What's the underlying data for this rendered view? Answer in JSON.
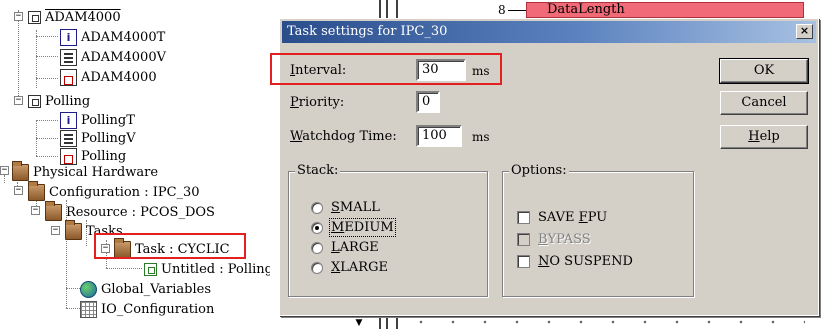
{
  "tree": {
    "items": [
      {
        "label": "ADAM4000",
        "icon": "program-group-icon"
      },
      {
        "label": "ADAM4000T",
        "icon": "type-icon"
      },
      {
        "label": "ADAM4000V",
        "icon": "variables-icon"
      },
      {
        "label": "ADAM4000",
        "icon": "program-icon"
      },
      {
        "label": "Polling",
        "icon": "program-group-icon"
      },
      {
        "label": "PollingT",
        "icon": "type-icon"
      },
      {
        "label": "PollingV",
        "icon": "variables-icon"
      },
      {
        "label": "Polling",
        "icon": "program-icon"
      },
      {
        "label": "Physical Hardware",
        "icon": "folder-icon"
      },
      {
        "label": "Configuration : IPC_30",
        "icon": "folder-icon"
      },
      {
        "label": "Resource : PCOS_DOS",
        "icon": "folder-icon"
      },
      {
        "label": "Tasks",
        "icon": "folder-icon"
      },
      {
        "label": "Task : CYCLIC",
        "icon": "folder-icon"
      },
      {
        "label": "Untitled : Polling",
        "icon": "program-instance-icon"
      },
      {
        "label": "Global_Variables",
        "icon": "globe-icon"
      },
      {
        "label": "IO_Configuration",
        "icon": "grid-icon"
      }
    ]
  },
  "background": {
    "diagram_number": "8",
    "diagram_label": "DataLength"
  },
  "dialog": {
    "title": "Task settings for IPC_30",
    "close_glyph": "×",
    "interval_label_u": "I",
    "interval_label_rest": "nterval:",
    "interval_value": "30",
    "interval_unit": "ms",
    "priority_label_u": "P",
    "priority_label_rest": "riority:",
    "priority_value": "0",
    "watchdog_label_u": "W",
    "watchdog_label_rest": "atchdog Time:",
    "watchdog_value": "100",
    "watchdog_unit": "ms",
    "ok_label": "OK",
    "cancel_label": "Cancel",
    "help_label_u": "H",
    "help_label_rest": "elp",
    "stack": {
      "title": "Stack:",
      "options": [
        {
          "u": "S",
          "rest": "MALL",
          "selected": false
        },
        {
          "u": "M",
          "rest": "EDIUM",
          "selected": true
        },
        {
          "u": "L",
          "rest": "ARGE",
          "selected": false
        },
        {
          "u": "X",
          "rest": "LARGE",
          "selected": false
        }
      ]
    },
    "options_group": {
      "title": "Options:",
      "save_fpu_pre": "SAVE ",
      "save_fpu_u": "F",
      "save_fpu_rest": "PU",
      "bypass_u": "B",
      "bypass_rest": "YPASS",
      "no_suspend_u": "N",
      "no_suspend_rest": "O SUSPEND"
    }
  },
  "colors": {
    "highlight": "#e22020",
    "titlebar_start": "#2a4d8c",
    "dialog_bg": "#d4d0c8",
    "datalength_fill": "#f06a78"
  }
}
